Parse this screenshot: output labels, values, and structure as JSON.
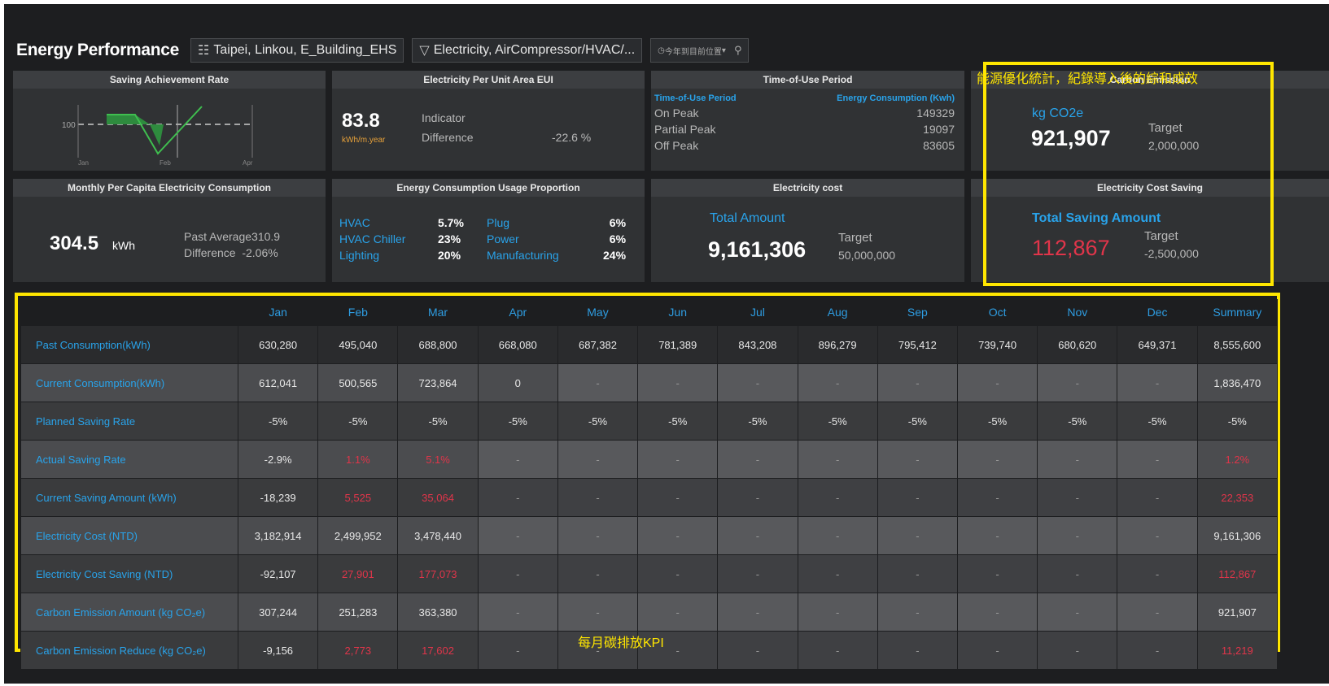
{
  "header": {
    "title": "Energy Performance",
    "location": "Taipei, Linkou, E_Building_EHS",
    "filter": "Electricity, AirCompressor/HVAC/...",
    "time": "今年到目前位置",
    "icons": {
      "location": "org-tree-icon",
      "filter": "filter-icon",
      "time": "clock-icon",
      "search": "search-icon"
    }
  },
  "annotations": {
    "top": "能源優化統計，紀錄導入後的綜和成效",
    "bottom": "每月碳排放KPI",
    "highlight_color": "#ffe600"
  },
  "cards": {
    "saving_rate": {
      "title": "Saving Achievement Rate",
      "y_tick": "100",
      "x_labels": [
        "Jan",
        "Feb",
        "Apr"
      ]
    },
    "eui": {
      "title": "Electricity Per Unit Area EUI",
      "value": "83.8",
      "unit": "kWh/m.year",
      "indicator": "Indicator",
      "difference_label": "Difference",
      "difference_value": "-22.6 %"
    },
    "tou": {
      "title": "Time-of-Use Period",
      "col1": "Time-of-Use Period",
      "col2": "Energy Consumption (Kwh)",
      "rows": [
        {
          "label": "On Peak",
          "value": "149329"
        },
        {
          "label": "Partial Peak",
          "value": "19097"
        },
        {
          "label": "Off Peak",
          "value": "83605"
        }
      ]
    },
    "carbon": {
      "title": "Carbon Emission",
      "unit": "kg CO2e",
      "value": "921,907",
      "target_label": "Target",
      "target_value": "2,000,000"
    },
    "per_capita": {
      "title": "Monthly Per Capita Electricity Consumption",
      "value": "304.5",
      "unit": "kWh",
      "past_label": "Past Average",
      "past_value": "310.9",
      "diff_label": "Difference",
      "diff_value": "-2.06%"
    },
    "usage": {
      "title": "Energy Consumption Usage Proportion",
      "left": [
        {
          "label": "HVAC",
          "value": "5.7%"
        },
        {
          "label": "HVAC Chiller",
          "value": "23%"
        },
        {
          "label": "Lighting",
          "value": "20%"
        }
      ],
      "right": [
        {
          "label": "Plug",
          "value": "6%"
        },
        {
          "label": "Power",
          "value": "6%"
        },
        {
          "label": "Manufacturing",
          "value": "24%"
        }
      ]
    },
    "cost": {
      "title": "Electricity cost",
      "label": "Total Amount",
      "value": "9,161,306",
      "target_label": "Target",
      "target_value": "50,000,000"
    },
    "cost_saving": {
      "title": "Electricity Cost Saving",
      "label": "Total Saving Amount",
      "value": "112,867",
      "target_label": "Target",
      "target_value": "-2,500,000",
      "value_color": "#e0354a"
    }
  },
  "table": {
    "columns": [
      "Jan",
      "Feb",
      "Mar",
      "Apr",
      "May",
      "Jun",
      "Jul",
      "Aug",
      "Sep",
      "Oct",
      "Nov",
      "Dec",
      "Summary"
    ],
    "rows": [
      {
        "label": "Past Consumption(kWh)",
        "cells": [
          "630,280",
          "495,040",
          "688,800",
          "668,080",
          "687,382",
          "781,389",
          "843,208",
          "896,279",
          "795,412",
          "739,740",
          "680,620",
          "649,371",
          "8,555,600"
        ]
      },
      {
        "label": "Current Consumption(kWh)",
        "cells": [
          "612,041",
          "500,565",
          "723,864",
          "0",
          "-",
          "-",
          "-",
          "-",
          "-",
          "-",
          "-",
          "-",
          "1,836,470"
        ]
      },
      {
        "label": "Planned Saving Rate",
        "cells": [
          "-5%",
          "-5%",
          "-5%",
          "-5%",
          "-5%",
          "-5%",
          "-5%",
          "-5%",
          "-5%",
          "-5%",
          "-5%",
          "-5%",
          "-5%"
        ]
      },
      {
        "label": "Actual Saving Rate",
        "cells": [
          "-2.9%",
          "1.1%",
          "5.1%",
          "-",
          "-",
          "-",
          "-",
          "-",
          "-",
          "-",
          "-",
          "-",
          "1.2%"
        ],
        "red": [
          1,
          2,
          12
        ]
      },
      {
        "label": "Current Saving Amount (kWh)",
        "cells": [
          "-18,239",
          "5,525",
          "35,064",
          "-",
          "-",
          "-",
          "-",
          "-",
          "-",
          "-",
          "-",
          "-",
          "22,353"
        ],
        "red": [
          1,
          2,
          12
        ]
      },
      {
        "label": "Electricity Cost (NTD)",
        "cells": [
          "3,182,914",
          "2,499,952",
          "3,478,440",
          "-",
          "-",
          "-",
          "-",
          "-",
          "-",
          "-",
          "-",
          "-",
          "9,161,306"
        ]
      },
      {
        "label": "Electricity Cost Saving (NTD)",
        "cells": [
          "-92,107",
          "27,901",
          "177,073",
          "-",
          "-",
          "-",
          "-",
          "-",
          "-",
          "-",
          "-",
          "-",
          "112,867"
        ],
        "red": [
          1,
          2,
          12
        ]
      },
      {
        "label": "Carbon Emission Amount (kg CO₂e)",
        "cells": [
          "307,244",
          "251,283",
          "363,380",
          "-",
          "-",
          "-",
          "-",
          "-",
          "-",
          "-",
          "-",
          "-",
          "921,907"
        ]
      },
      {
        "label": "Carbon Emission Reduce (kg CO₂e)",
        "cells": [
          "-9,156",
          "2,773",
          "17,602",
          "-",
          "-",
          "-",
          "-",
          "-",
          "-",
          "-",
          "-",
          "-",
          "11,219"
        ],
        "red": [
          1,
          2,
          12
        ]
      }
    ]
  }
}
